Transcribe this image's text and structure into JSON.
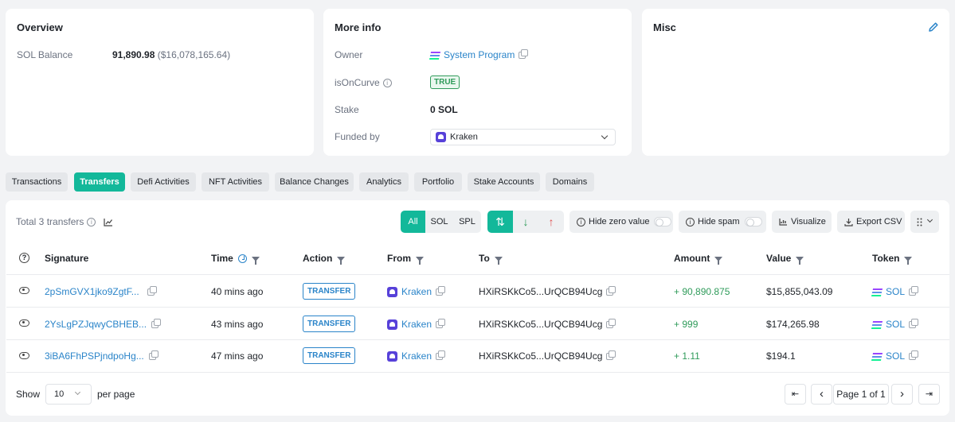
{
  "overview": {
    "title": "Overview",
    "sol_balance_label": "SOL Balance",
    "sol_balance_value": "91,890.98",
    "sol_balance_usd": "($16,078,165.64)"
  },
  "more_info": {
    "title": "More info",
    "owner_label": "Owner",
    "owner_value": "System Program",
    "is_on_curve_label": "isOnCurve",
    "is_on_curve_value": "TRUE",
    "stake_label": "Stake",
    "stake_value": "0 SOL",
    "funded_by_label": "Funded by",
    "funded_by_value": "Kraken"
  },
  "misc": {
    "title": "Misc",
    "edit_icon": "pencil-icon"
  },
  "tabs": [
    {
      "label": "Transactions"
    },
    {
      "label": "Transfers"
    },
    {
      "label": "Defi Activities"
    },
    {
      "label": "NFT Activities"
    },
    {
      "label": "Balance Changes"
    },
    {
      "label": "Analytics"
    },
    {
      "label": "Portfolio"
    },
    {
      "label": "Stake Accounts"
    },
    {
      "label": "Domains"
    }
  ],
  "active_tab": "Transfers",
  "toolbar": {
    "total_label": "Total 3 transfers",
    "filter_all": "All",
    "filter_sol": "SOL",
    "filter_spl": "SPL",
    "hide_zero_label": "Hide zero value",
    "hide_spam_label": "Hide spam",
    "visualize_label": "Visualize",
    "export_label": "Export CSV",
    "direction_both": "⇅",
    "direction_in": "↓",
    "direction_out": "↑"
  },
  "table": {
    "headers": {
      "signature": "Signature",
      "time": "Time",
      "action": "Action",
      "from": "From",
      "to": "To",
      "amount": "Amount",
      "value": "Value",
      "token": "Token"
    },
    "rows": [
      {
        "signature": "2pSmGVX1jko9ZgtF...",
        "time": "40 mins ago",
        "action": "TRANSFER",
        "from": "Kraken",
        "to": "HXiRSKkCo5...UrQCB94Ucg",
        "amount": "+ 90,890.875",
        "value": "$15,855,043.09",
        "token": "SOL"
      },
      {
        "signature": "2YsLgPZJqwyCBHEB...",
        "time": "43 mins ago",
        "action": "TRANSFER",
        "from": "Kraken",
        "to": "HXiRSKkCo5...UrQCB94Ucg",
        "amount": "+ 999",
        "value": "$174,265.98",
        "token": "SOL"
      },
      {
        "signature": "3iBA6FhPSPjndpoHg...",
        "time": "47 mins ago",
        "action": "TRANSFER",
        "from": "Kraken",
        "to": "HXiRSKkCo5...UrQCB94Ucg",
        "amount": "+ 1.11",
        "value": "$194.1",
        "token": "SOL"
      }
    ]
  },
  "pagination": {
    "show_label": "Show",
    "page_size": "10",
    "per_page_label": "per page",
    "page_text": "Page 1 of 1",
    "first": "⇤",
    "prev": "‹",
    "next": "›",
    "last": "⇥"
  },
  "colors": {
    "accent": "#13b89a",
    "link": "#2a84c9",
    "positive": "#2f9b5a"
  }
}
